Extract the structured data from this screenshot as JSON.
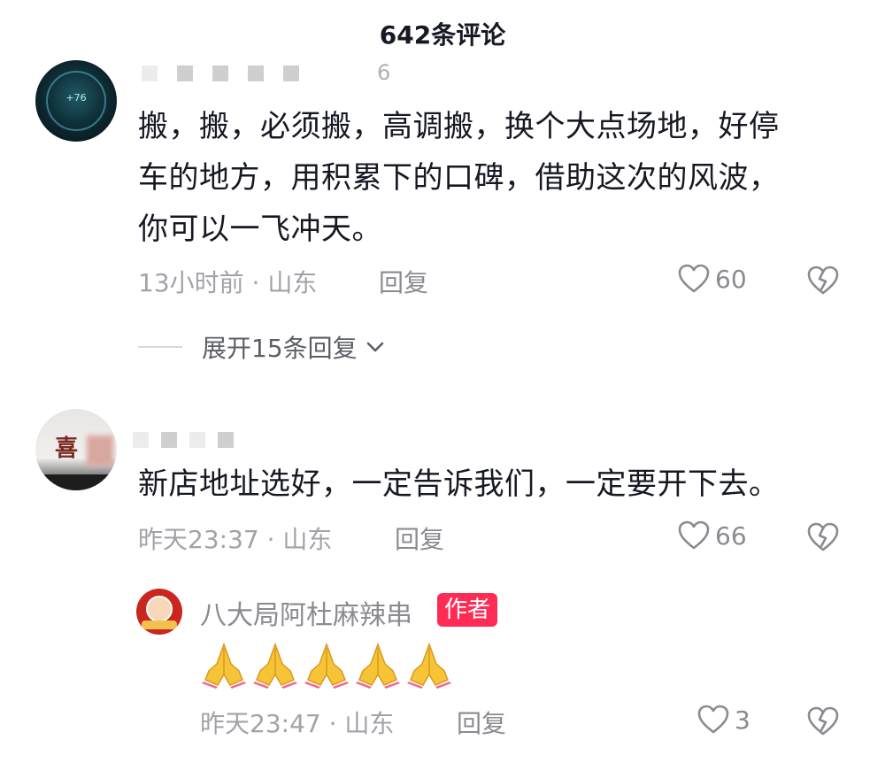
{
  "header": {
    "title": "642条评论"
  },
  "comments": [
    {
      "username_tail": "6",
      "text_lines": [
        "搬，搬，必须搬，高调搬，换个大点场地，好停",
        "车的地方，用积累下的口碑，借助这次的风波，",
        "你可以一飞冲天。"
      ],
      "time": "13小时前",
      "location": "山东",
      "reply_label": "回复",
      "likes": "60",
      "avatar_text": "+76",
      "expand_label": "展开15条回复"
    },
    {
      "avatar_glyph": "喜",
      "text_lines": [
        "新店地址选好，一定告诉我们，一定要开下去。"
      ],
      "time": "昨天23:37",
      "location": "山东",
      "reply_label": "回复",
      "likes": "66"
    }
  ],
  "reply": {
    "name": "八大局阿杜麻辣串",
    "author_tag": "作者",
    "emoji": [
      "🙏",
      "🙏",
      "🙏",
      "🙏",
      "🙏"
    ],
    "time": "昨天23:47",
    "location": "山东",
    "reply_label": "回复",
    "likes": "3"
  },
  "icons": {
    "like": "heart-outline-icon",
    "dislike": "broken-heart-icon",
    "expand": "chevron-down-icon"
  },
  "colors": {
    "author_tag": "#fe2c55",
    "meta": "#a2a3a8",
    "text": "#161823"
  }
}
